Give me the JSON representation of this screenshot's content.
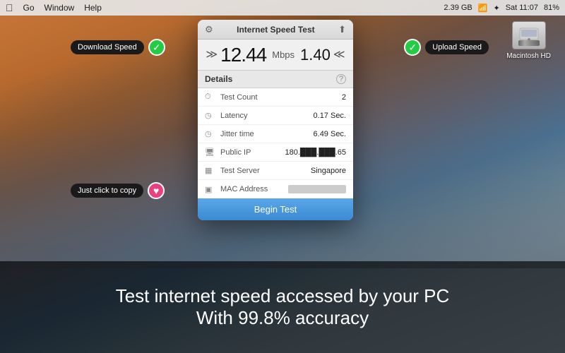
{
  "menubar": {
    "apple": "⌘",
    "items": [
      "Go",
      "Window",
      "Help"
    ],
    "right": {
      "data": "2.39 GB",
      "wifi": "WiFi",
      "bluetooth": "BT",
      "time": "Sat 11:07",
      "battery": "81%"
    }
  },
  "desktop": {
    "hd_label": "Macintosh HD"
  },
  "window": {
    "title": "Internet Speed Test",
    "download_speed": "12.44",
    "upload_speed": "1.40",
    "speed_unit": "Mbps",
    "details_title": "Details",
    "rows": [
      {
        "icon": "⏱",
        "label": "Test Count",
        "value": "2"
      },
      {
        "icon": "◷",
        "label": "Latency",
        "value": "0.17 Sec."
      },
      {
        "icon": "◷",
        "label": "Jitter time",
        "value": "6.49 Sec."
      },
      {
        "icon": "🖥",
        "label": "Public IP",
        "value": "180.███.███.65"
      },
      {
        "icon": "▦",
        "label": "Test Server",
        "value": "Singapore"
      },
      {
        "icon": "▣",
        "label": "MAC Address",
        "value": "blurred"
      }
    ],
    "begin_btn": "Begin Test"
  },
  "badges": {
    "download_label": "Download Speed",
    "upload_label": "Upload Speed",
    "copy_label": "Just click to copy"
  },
  "bottom": {
    "line1": "Test internet speed accessed by your PC",
    "line2": "With 99.8% accuracy"
  }
}
